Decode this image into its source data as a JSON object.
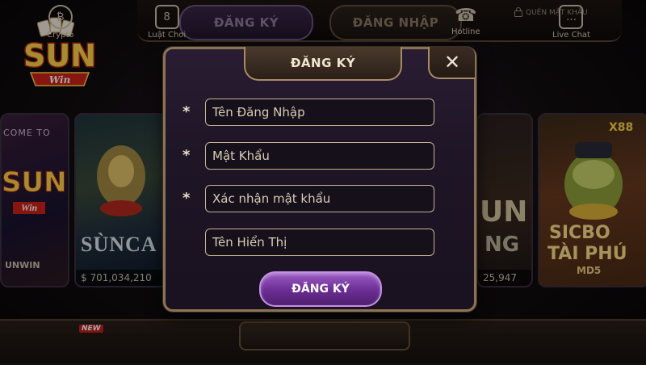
{
  "topbar": {
    "register_label": "ĐĂNG KÝ",
    "login_label": "ĐĂNG NHẬP",
    "forgot_label": "QUÊN MẬT KHẨU"
  },
  "logo": {
    "text": "SUN",
    "sub": "Win"
  },
  "cards": {
    "left_welcome": "COME TO",
    "left_logo": "SUN",
    "left_logo_sub": "Win",
    "left_footer": "UNWIN",
    "sunca_label": "SÙNCA",
    "sunca_jackpot": "$ 701,034,210",
    "mid_label": "UN",
    "mid_sub": "NG",
    "mid_jackpot": "25,947",
    "sicbo_badge": "X88",
    "sicbo_title": "SICBO",
    "sicbo_sub": "TÀI PHÚ",
    "sicbo_md5": "MD5"
  },
  "bottombar": {
    "crypto": "Crypto",
    "new_badge": "NEW",
    "rules": "Luật Chơi",
    "hotline": "Hotline",
    "livechat": "Live Chat"
  },
  "modal": {
    "title": "ĐĂNG KÝ",
    "close": "✕",
    "fields": [
      {
        "placeholder": "Tên Đăng Nhập",
        "required": "*"
      },
      {
        "placeholder": "Mật Khẩu",
        "required": "*"
      },
      {
        "placeholder": "Xác nhận mật khẩu",
        "required": "*"
      },
      {
        "placeholder": "Tên Hiển Thị",
        "required": ""
      }
    ],
    "submit": "ĐĂNG KÝ"
  },
  "colors": {
    "accent_purple": "#7a3aa8",
    "gold_border": "#a88b66",
    "background": "#0d0a0b"
  }
}
